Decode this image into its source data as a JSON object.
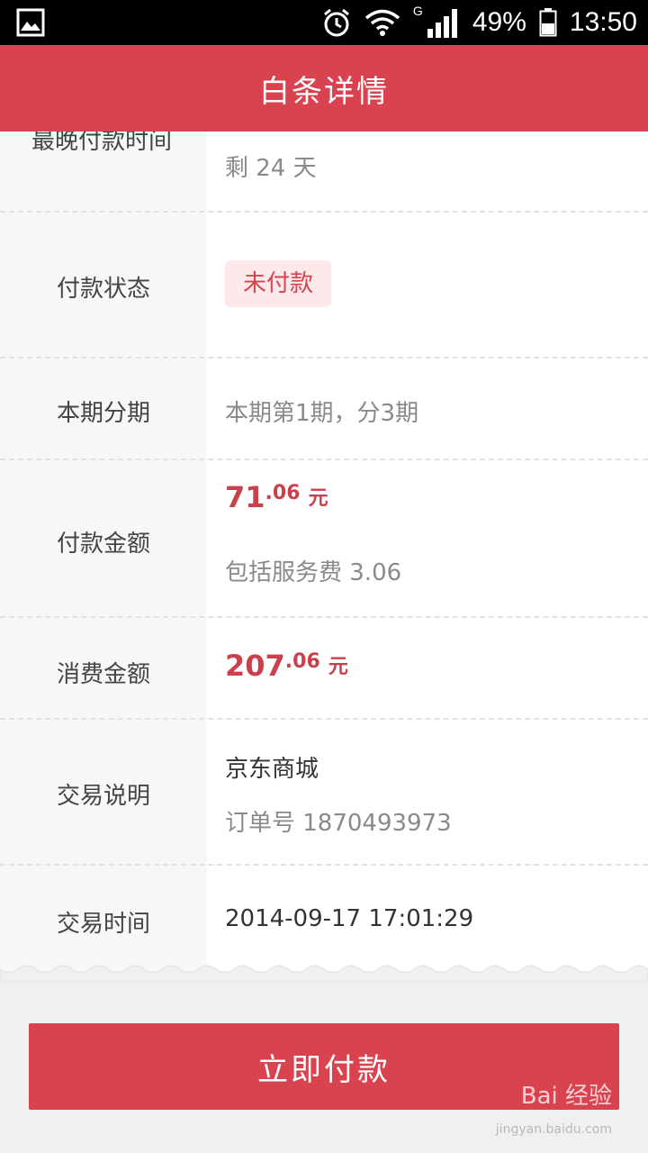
{
  "status_bar": {
    "signal_type": "G",
    "battery": "49%",
    "time": "13:50",
    "icons": [
      "gallery-icon",
      "alarm-icon",
      "wifi-icon",
      "signal-icon",
      "battery-icon"
    ]
  },
  "header": {
    "title": "白条详情"
  },
  "rows": [
    {
      "label": "最晚付款时间",
      "value": "剩 24 天"
    },
    {
      "label": "付款状态",
      "badge": "未付款"
    },
    {
      "label": "本期分期",
      "value": "本期第1期，分3期"
    },
    {
      "label": "付款金额",
      "amount_int": "71",
      "amount_dec": ".06",
      "amount_unit": "元",
      "sub": "包括服务费 3.06"
    },
    {
      "label": "消费金额",
      "amount_int": "207",
      "amount_dec": ".06",
      "amount_unit": "元"
    },
    {
      "label": "交易说明",
      "value": "京东商城",
      "sub": "订单号 1870493973"
    },
    {
      "label": "交易时间",
      "value": "2014-09-17 17:01:29"
    }
  ],
  "pay_button": {
    "label": "立即付款"
  },
  "watermark": {
    "brand": "Bai 经验",
    "url": "jingyan.baidu.com"
  },
  "colors": {
    "accent": "#d8434f",
    "amount": "#c9414c",
    "badge_bg": "#fde8ea"
  }
}
